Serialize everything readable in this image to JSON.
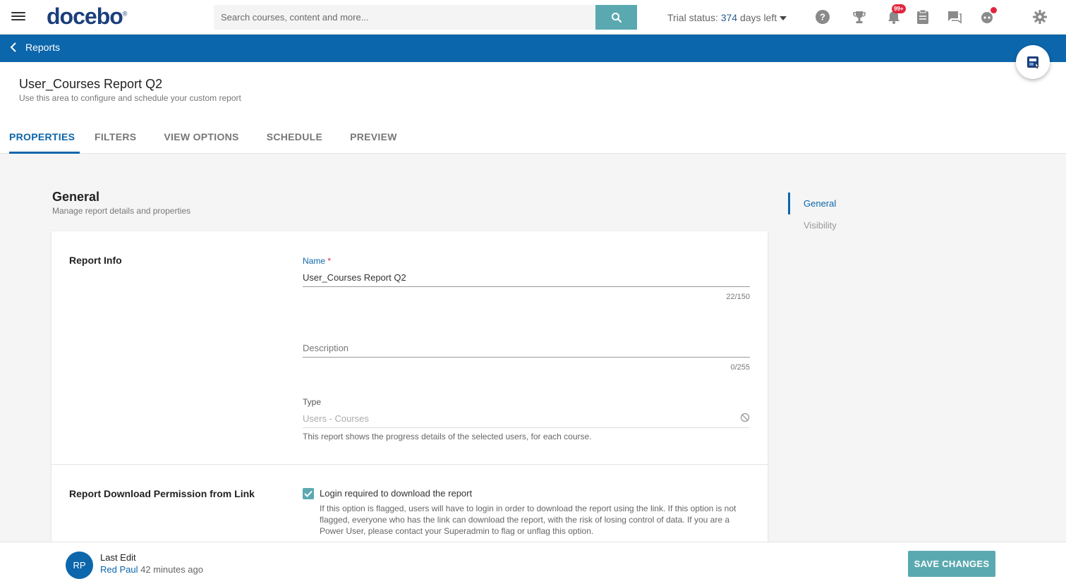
{
  "header": {
    "logo_text": "docebo",
    "logo_mark": "®",
    "search_placeholder": "Search courses, content and more...",
    "trial_prefix": "Trial status: ",
    "trial_days": "374",
    "trial_suffix": " days left",
    "notification_count": "99+",
    "icons": [
      "menu-icon",
      "search-icon",
      "help-icon",
      "trophy-icon",
      "bell-icon",
      "clipboard-icon",
      "chat-icon",
      "bot-icon",
      "gear-icon"
    ]
  },
  "breadcrumb": {
    "back_label": "Reports"
  },
  "page": {
    "title": "User_Courses Report Q2",
    "subtitle": "Use this area to configure and schedule your custom report"
  },
  "tabs": [
    {
      "label": "PROPERTIES",
      "active": true
    },
    {
      "label": "FILTERS",
      "active": false
    },
    {
      "label": "VIEW OPTIONS",
      "active": false
    },
    {
      "label": "SCHEDULE",
      "active": false
    },
    {
      "label": "PREVIEW",
      "active": false
    }
  ],
  "section": {
    "title": "General",
    "subtitle": "Manage report details and properties"
  },
  "report_info": {
    "label": "Report Info",
    "name_label": "Name",
    "name_required": "*",
    "name_value": "User_Courses Report Q2",
    "name_counter": "22/150",
    "description_placeholder": "Description",
    "description_counter": "0/255",
    "type_label": "Type",
    "type_value": "Users - Courses",
    "type_hint": "This report shows the progress details of the selected users, for each course."
  },
  "download_permission": {
    "label": "Report Download Permission from Link",
    "checkbox_label": "Login required to download the report",
    "checked": true,
    "description": "If this option is flagged, users will have to login in order to download the report using the link. If this option is not flagged, everyone who has the link can download the report, with the risk of losing control of data. If you are a Power User, please contact your Superadmin to flag or unflag this option."
  },
  "anchor_nav": [
    {
      "label": "General",
      "active": true
    },
    {
      "label": "Visibility",
      "active": false
    }
  ],
  "footer": {
    "avatar_initials": "RP",
    "last_edit_label": "Last Edit",
    "editor_name": "Red Paul",
    "edit_time": "42 minutes ago",
    "save_label": "SAVE CHANGES"
  },
  "colors": {
    "primary_blue": "#0c66ab",
    "teal": "#5ba9b0",
    "badge_red": "#e0263d",
    "logo_navy": "#1c3f7c"
  }
}
